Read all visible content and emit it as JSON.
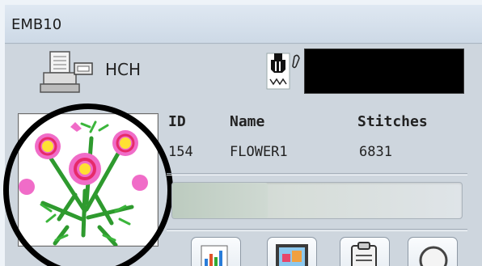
{
  "window": {
    "title": "EMB10"
  },
  "machine": {
    "name": "HCH",
    "icon": "embroidery-machine-icon",
    "needle_icon": "needle-presser-foot-icon"
  },
  "design": {
    "thumbnail_icon": "flower-design-thumbnail",
    "columns": {
      "id": "ID",
      "name": "Name",
      "stitches": "Stitches"
    },
    "values": {
      "id": "154",
      "name": "FLOWER1",
      "stitches": "6831"
    }
  },
  "progress": {
    "level": 0.33
  },
  "toolbar": {
    "buttons": [
      {
        "icon": "chart-icon"
      },
      {
        "icon": "image-icon"
      },
      {
        "icon": "clipboard-icon"
      },
      {
        "icon": "circle-icon"
      }
    ]
  },
  "colors": {
    "accent_highlight": "#000000",
    "display_bg": "#000000",
    "panel_bg": "#ced6de"
  }
}
